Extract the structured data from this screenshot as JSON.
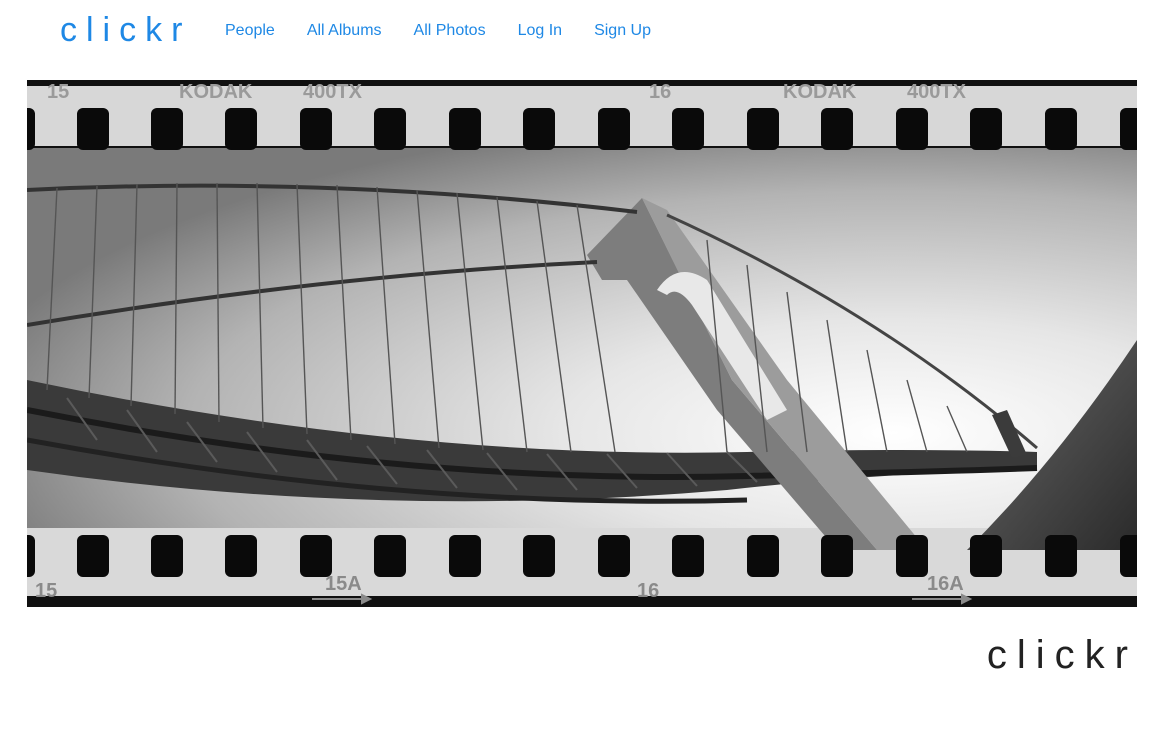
{
  "header": {
    "brand": "clickr",
    "nav": [
      {
        "label": "People"
      },
      {
        "label": "All Albums"
      },
      {
        "label": "All Photos"
      },
      {
        "label": "Log In"
      },
      {
        "label": "Sign Up"
      }
    ]
  },
  "hero": {
    "film_edge_top": [
      "15",
      "KODAK",
      "400TX",
      "16",
      "KODAK",
      "400TX"
    ],
    "film_edge_bottom": [
      "15",
      "15A",
      "16",
      "16A"
    ]
  },
  "footer": {
    "brand": "clickr"
  },
  "colors": {
    "accent": "#1e88e5",
    "footer_text": "#222222"
  }
}
